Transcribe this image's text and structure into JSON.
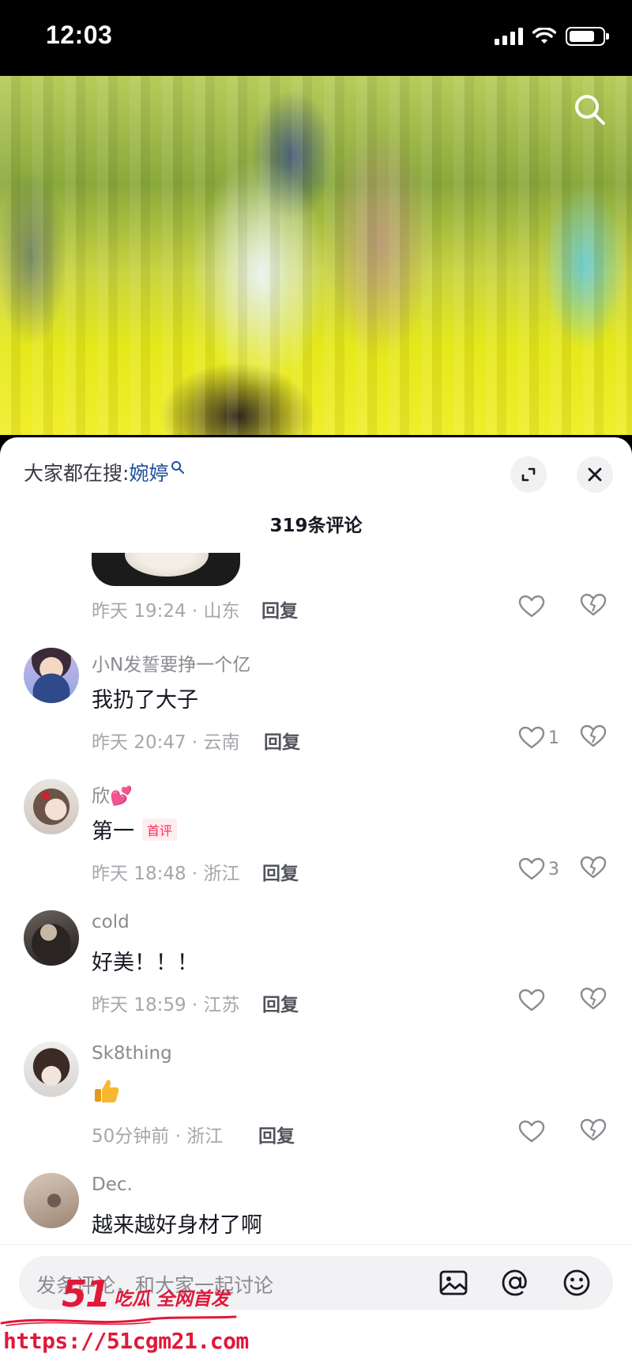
{
  "status_bar": {
    "time": "12:03"
  },
  "video": {
    "search_icon": "search-icon"
  },
  "sheet": {
    "hot_search_prefix": "大家都在搜:",
    "hot_search_keyword": "婉婷",
    "comment_count": "319条评论"
  },
  "comments": [
    {
      "name": "",
      "text": "",
      "meta": "昨天 19:24 · 山东",
      "reply": "回复",
      "likes": ""
    },
    {
      "name": "小N发誓要挣一个亿",
      "text": "我扔了大子",
      "meta": "昨天 20:47 · 云南",
      "reply": "回复",
      "likes": "1"
    },
    {
      "name": "欣💕",
      "text": "第一",
      "badge": "首评",
      "meta": "昨天 18:48 · 浙江",
      "reply": "回复",
      "likes": "3"
    },
    {
      "name": "cold",
      "text": "好美！！！",
      "meta": "昨天 18:59 · 江苏",
      "reply": "回复",
      "likes": ""
    },
    {
      "name": "Sk8thing",
      "text": "👍",
      "meta": "50分钟前 · 浙江",
      "reply": "回复",
      "likes": ""
    },
    {
      "name": "Dec.",
      "text": "越来越好身材了啊",
      "meta": "",
      "reply": "",
      "likes": ""
    }
  ],
  "input": {
    "placeholder": "发条评论，和大家一起讨论",
    "icons": [
      "image-icon",
      "at-icon",
      "emoji-icon"
    ]
  },
  "watermark": {
    "brand": "51",
    "tagline": "吃瓜 全网首发",
    "url": "https://51cgm21.com"
  },
  "colors": {
    "accent_red": "#fe2c55",
    "keyword_blue": "#1f4f9a",
    "watermark_red": "#e0183a"
  }
}
